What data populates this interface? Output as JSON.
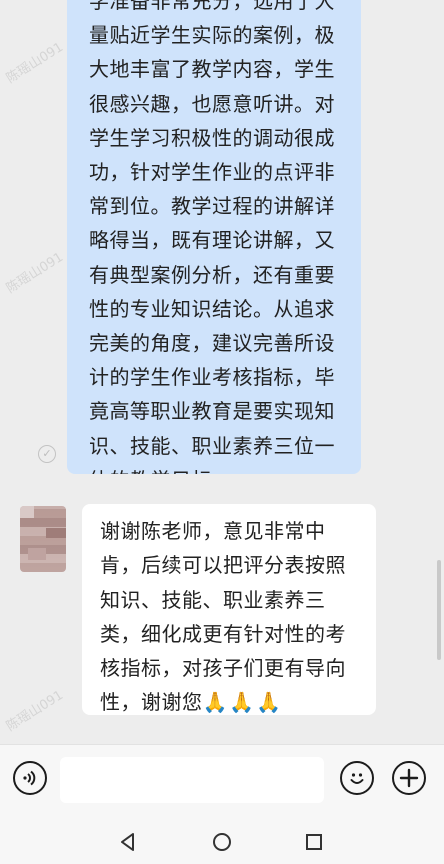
{
  "messages": {
    "sent": {
      "text": "学准备非常充分，选用了大量贴近学生实际的案例，极大地丰富了教学内容，学生很感兴趣，也愿意听讲。对学生学习积极性的调动很成功，针对学生作业的点评非常到位。教学过程的讲解详略得当，既有理论讲解，又有典型案例分析，还有重要性的专业知识结论。从追求完美的角度，建议完善所设计的学生作业考核指标，毕竟高等职业教育是要实现知识、技能、职业素养三位一体的教学目标。"
    },
    "received": {
      "text": "谢谢陈老师，意见非常中肯，后续可以把评分表按照知识、技能、职业素养三类，细化成更有针对性的考核指标，对孩子们更有导向性，谢谢您",
      "emoji": "🙏🙏🙏"
    }
  },
  "watermark": {
    "text": "陈瑶山091"
  },
  "input_bar": {
    "placeholder": ""
  },
  "icons": {
    "voice": "voice-icon",
    "emoji": "emoji-icon",
    "plus": "plus-icon",
    "check": "check-icon",
    "nav_back": "back-triangle-icon",
    "nav_home": "home-circle-icon",
    "nav_recent": "recent-square-icon"
  }
}
